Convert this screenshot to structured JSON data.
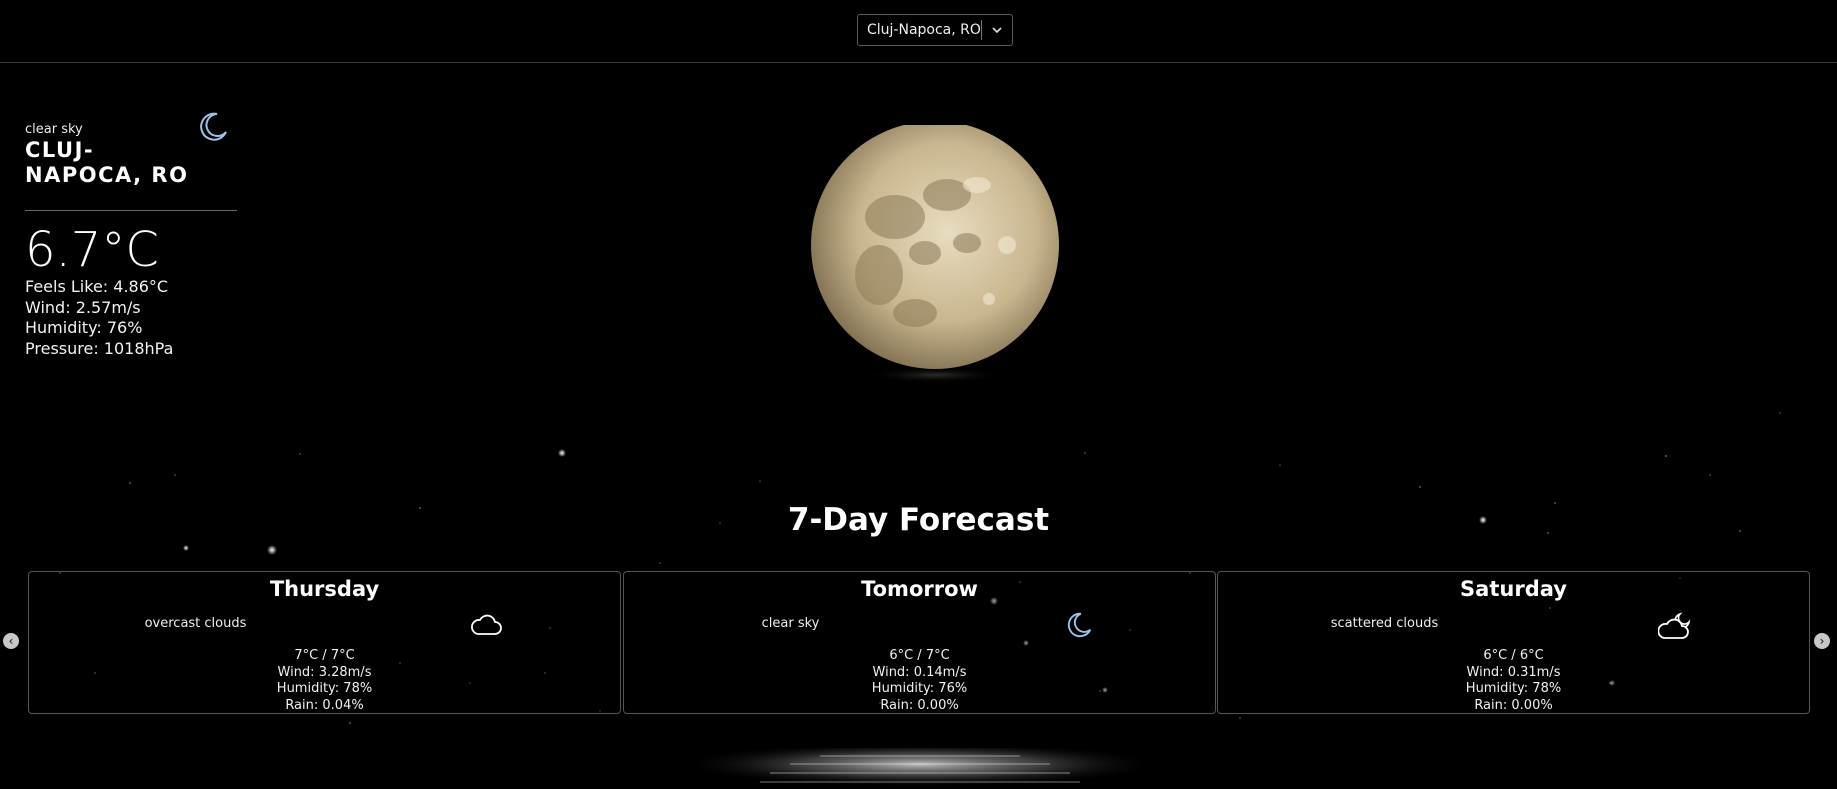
{
  "header": {
    "location_select": {
      "selected": "Cluj-Napoca, RO"
    }
  },
  "current": {
    "description": "clear sky",
    "city": "CLUJ-NAPOCA, RO",
    "icon": "moon-icon",
    "temperature": "6.7°C",
    "feels_like": "Feels Like: 4.86°C",
    "wind": "Wind: 2.57m/s",
    "humidity": "Humidity: 76%",
    "pressure": "Pressure: 1018hPa"
  },
  "forecast": {
    "title": "7-Day Forecast",
    "days": [
      {
        "day": "Thursday",
        "description": "overcast clouds",
        "icon": "cloud-icon",
        "temps": "7°C / 7°C",
        "wind": "Wind: 3.28m/s",
        "humidity": "Humidity: 78%",
        "rain": "Rain: 0.04%"
      },
      {
        "day": "Tomorrow",
        "description": "clear sky",
        "icon": "moon-icon",
        "temps": "6°C / 7°C",
        "wind": "Wind: 0.14m/s",
        "humidity": "Humidity: 76%",
        "rain": "Rain: 0.00%"
      },
      {
        "day": "Saturday",
        "description": "scattered clouds",
        "icon": "cloud-moon-icon",
        "temps": "6°C / 6°C",
        "wind": "Wind: 0.31m/s",
        "humidity": "Humidity: 78%",
        "rain": "Rain: 0.00%"
      }
    ]
  },
  "colors": {
    "background": "#000000",
    "icon": "#9fc3e8",
    "text": "#ffffff",
    "border": "#555555"
  }
}
